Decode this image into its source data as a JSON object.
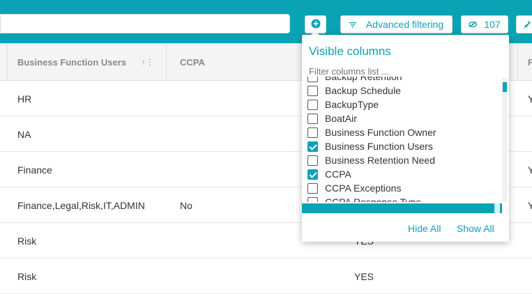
{
  "toolbar": {
    "advanced_filtering_label": "Advanced filtering",
    "visible_count": "107"
  },
  "headers": {
    "business_function_users": "Business Function Users",
    "ccpa": "CCPA",
    "partial_right": "F"
  },
  "rows": [
    {
      "users": "HR",
      "ccpa": "",
      "col3": "",
      "right": "Y"
    },
    {
      "users": "NA",
      "ccpa": "",
      "col3": "",
      "right": ""
    },
    {
      "users": "Finance",
      "ccpa": "",
      "col3": "",
      "right": "Y"
    },
    {
      "users": "Finance,Legal,Risk,IT,ADMIN",
      "ccpa": "No",
      "col3": "",
      "right": "Y"
    },
    {
      "users": "Risk",
      "ccpa": "",
      "col3": "YES",
      "right": ""
    },
    {
      "users": "Risk",
      "ccpa": "",
      "col3": "YES",
      "right": ""
    }
  ],
  "popup": {
    "title": "Visible columns",
    "filter_placeholder": "Filter columns list ...",
    "options": [
      {
        "label": "Backup Retention",
        "checked": false
      },
      {
        "label": "Backup Schedule",
        "checked": false
      },
      {
        "label": "BackupType",
        "checked": false
      },
      {
        "label": "BoatAir",
        "checked": false
      },
      {
        "label": "Business Function Owner",
        "checked": false
      },
      {
        "label": "Business Function Users",
        "checked": true
      },
      {
        "label": "Business Retention Need",
        "checked": false
      },
      {
        "label": "CCPA",
        "checked": true
      },
      {
        "label": "CCPA Exceptions",
        "checked": false
      },
      {
        "label": "CCPA Response Type",
        "checked": false
      }
    ],
    "hide_all": "Hide All",
    "show_all": "Show All"
  },
  "colors": {
    "accent": "#0aa3b5",
    "header_bg": "#f4f4f4"
  }
}
